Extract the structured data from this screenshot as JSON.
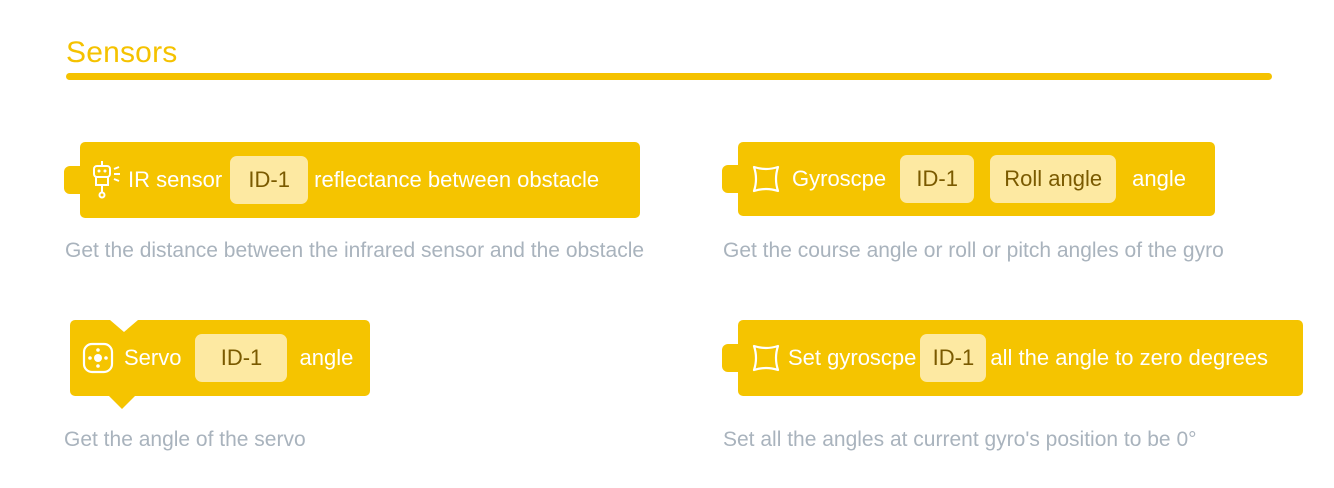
{
  "section": {
    "title": "Sensors"
  },
  "blocks": {
    "ir": {
      "icon": "robot-ir-icon",
      "label": "IR sensor",
      "id_value": "ID-1",
      "suffix": "reflectance between obstacle",
      "description": "Get the distance between the infrared sensor and the obstacle"
    },
    "gyro": {
      "icon": "gyroscope-icon",
      "label": "Gyroscpe",
      "id_value": "ID-1",
      "axis_value": "Roll angle",
      "suffix": "angle",
      "description": "Get the course angle or roll or pitch angles of the gyro"
    },
    "servo": {
      "icon": "servo-icon",
      "label": "Servo",
      "id_value": "ID-1",
      "suffix": "angle",
      "description": "Get the angle of the servo"
    },
    "gyro_reset": {
      "icon": "gyroscope-icon",
      "label": "Set gyroscpe",
      "id_value": "ID-1",
      "suffix": "all the angle to zero degrees",
      "description": "Set all the angles at current gyro's position to be 0°"
    }
  },
  "colors": {
    "accent": "#f5c200",
    "block": "#f5c400",
    "field": "#fde9a2",
    "description_text": "#a9b3bd"
  }
}
